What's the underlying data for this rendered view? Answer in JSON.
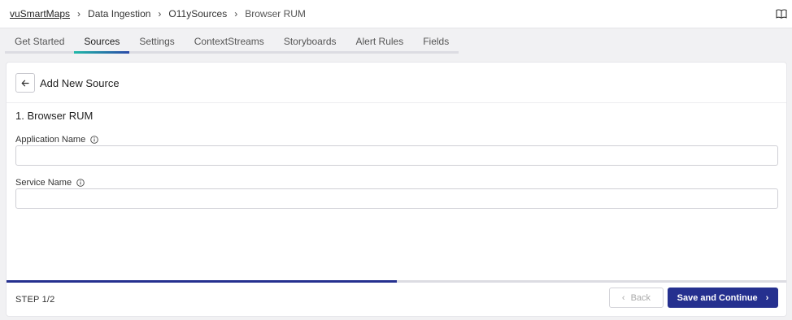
{
  "breadcrumb": {
    "items": [
      {
        "label": "vuSmartMaps"
      },
      {
        "label": "Data Ingestion"
      },
      {
        "label": "O11ySources"
      },
      {
        "label": "Browser RUM"
      }
    ],
    "separator": "›"
  },
  "header": {
    "doc_icon": "book-icon"
  },
  "tabs": [
    {
      "label": "Get Started",
      "active": false
    },
    {
      "label": "Sources",
      "active": true
    },
    {
      "label": "Settings",
      "active": false
    },
    {
      "label": "ContextStreams",
      "active": false
    },
    {
      "label": "Storyboards",
      "active": false
    },
    {
      "label": "Alert Rules",
      "active": false
    },
    {
      "label": "Fields",
      "active": false
    }
  ],
  "card": {
    "title": "Add New Source",
    "section_title": "1. Browser RUM",
    "fields": [
      {
        "label": "Application Name",
        "value": "",
        "placeholder": ""
      },
      {
        "label": "Service Name",
        "value": "",
        "placeholder": ""
      }
    ]
  },
  "footer": {
    "step_label": "STEP 1/2",
    "progress": 0.5,
    "back_label": "Back",
    "save_label": "Save and Continue"
  },
  "colors": {
    "primary": "#25308f",
    "tab_accent_start": "#20b8a8",
    "tab_accent_end": "#2b4aa8"
  }
}
